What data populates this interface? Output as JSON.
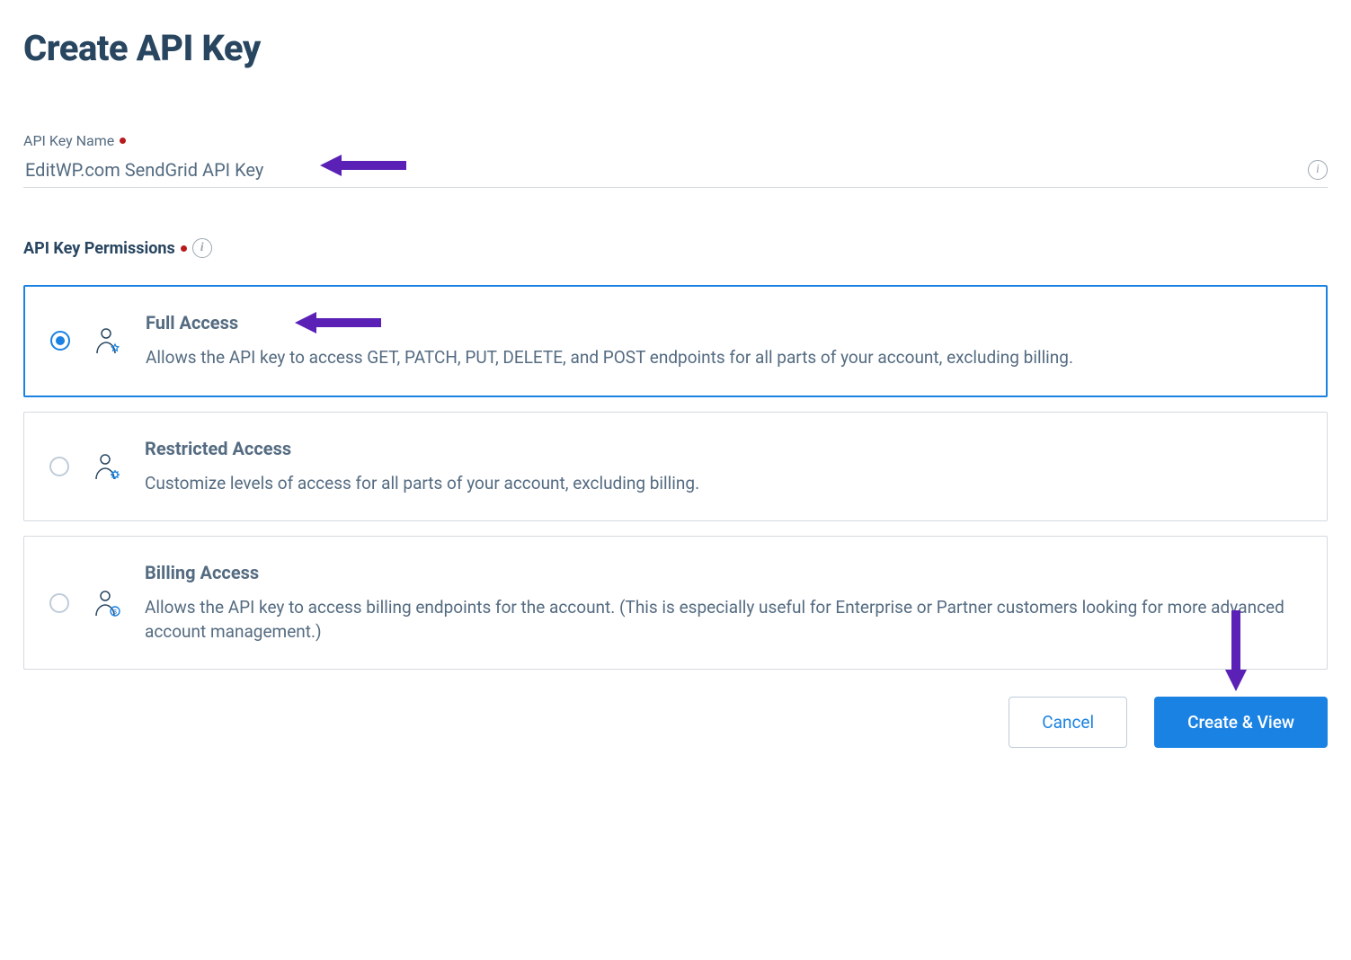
{
  "page": {
    "title": "Create API Key"
  },
  "fields": {
    "api_key_name_label": "API Key Name",
    "api_key_name_value": "EditWP.com SendGrid API Key",
    "permissions_label": "API Key Permissions"
  },
  "info_icon_glyph": "i",
  "permissions": {
    "full": {
      "title": "Full Access",
      "description": "Allows the API key to access GET, PATCH, PUT, DELETE, and POST endpoints for all parts of your account, excluding billing."
    },
    "restricted": {
      "title": "Restricted Access",
      "description": "Customize levels of access for all parts of your account, excluding billing."
    },
    "billing": {
      "title": "Billing Access",
      "description": "Allows the API key to access billing endpoints for the account. (This is especially useful for Enterprise or Partner customers looking for more advanced account management.)"
    }
  },
  "buttons": {
    "cancel": "Cancel",
    "create": "Create & View"
  },
  "colors": {
    "accent": "#1a82e2",
    "text_dark": "#294661",
    "text": "#546b81",
    "annotation": "#5b21b6",
    "required": "#b71c1c"
  }
}
